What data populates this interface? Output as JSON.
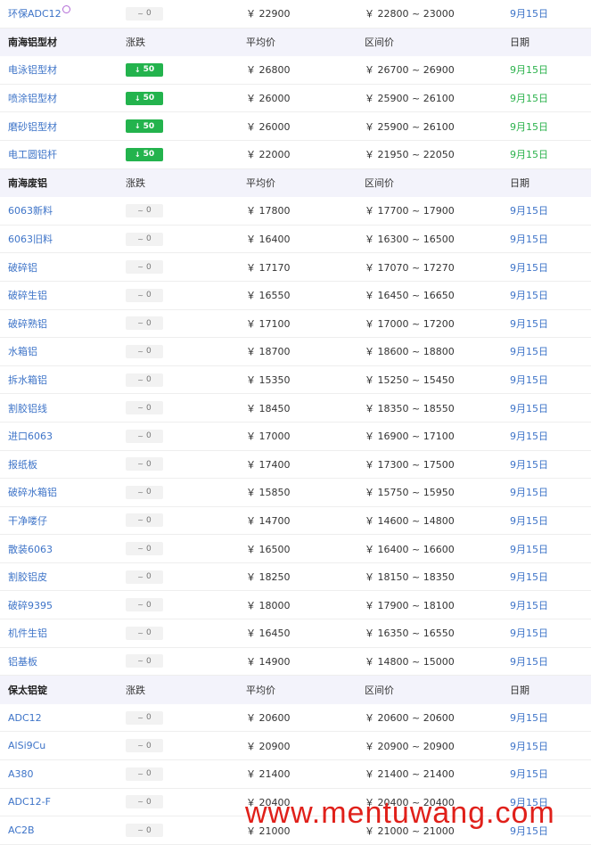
{
  "sections": [
    {
      "header": null,
      "rows": [
        {
          "name": "环保ADC12",
          "tag": true,
          "change": "0",
          "change_type": "flat",
          "avg": "￥ 22900",
          "range": "￥ 22800 ~ 23000",
          "date": "9月15日"
        }
      ]
    },
    {
      "header": {
        "title": "南海铝型材",
        "change": "涨跌",
        "avg": "平均价",
        "range": "区间价",
        "date": "日期"
      },
      "rows": [
        {
          "name": "电泳铝型材",
          "change": "50",
          "change_type": "down",
          "avg": "￥ 26800",
          "range": "￥ 26700 ~ 26900",
          "date": "9月15日",
          "date_color": "green"
        },
        {
          "name": "喷涂铝型材",
          "change": "50",
          "change_type": "down",
          "avg": "￥ 26000",
          "range": "￥ 25900 ~ 26100",
          "date": "9月15日",
          "date_color": "green"
        },
        {
          "name": "磨砂铝型材",
          "change": "50",
          "change_type": "down",
          "avg": "￥ 26000",
          "range": "￥ 25900 ~ 26100",
          "date": "9月15日",
          "date_color": "green"
        },
        {
          "name": "电工圆铝杆",
          "change": "50",
          "change_type": "down",
          "avg": "￥ 22000",
          "range": "￥ 21950 ~ 22050",
          "date": "9月15日",
          "date_color": "green"
        }
      ]
    },
    {
      "header": {
        "title": "南海废铝",
        "change": "涨跌",
        "avg": "平均价",
        "range": "区间价",
        "date": "日期"
      },
      "rows": [
        {
          "name": "6063新料",
          "change": "0",
          "change_type": "flat",
          "avg": "￥ 17800",
          "range": "￥ 17700 ~ 17900",
          "date": "9月15日"
        },
        {
          "name": "6063旧料",
          "change": "0",
          "change_type": "flat",
          "avg": "￥ 16400",
          "range": "￥ 16300 ~ 16500",
          "date": "9月15日"
        },
        {
          "name": "破碎铝",
          "change": "0",
          "change_type": "flat",
          "avg": "￥ 17170",
          "range": "￥ 17070 ~ 17270",
          "date": "9月15日"
        },
        {
          "name": "破碎生铝",
          "change": "0",
          "change_type": "flat",
          "avg": "￥ 16550",
          "range": "￥ 16450 ~ 16650",
          "date": "9月15日"
        },
        {
          "name": "破碎熟铝",
          "change": "0",
          "change_type": "flat",
          "avg": "￥ 17100",
          "range": "￥ 17000 ~ 17200",
          "date": "9月15日"
        },
        {
          "name": "水箱铝",
          "change": "0",
          "change_type": "flat",
          "avg": "￥ 18700",
          "range": "￥ 18600 ~ 18800",
          "date": "9月15日"
        },
        {
          "name": "拆水箱铝",
          "change": "0",
          "change_type": "flat",
          "avg": "￥ 15350",
          "range": "￥ 15250 ~ 15450",
          "date": "9月15日"
        },
        {
          "name": "割胶铝线",
          "change": "0",
          "change_type": "flat",
          "avg": "￥ 18450",
          "range": "￥ 18350 ~ 18550",
          "date": "9月15日"
        },
        {
          "name": "进口6063",
          "change": "0",
          "change_type": "flat",
          "avg": "￥ 17000",
          "range": "￥ 16900 ~ 17100",
          "date": "9月15日"
        },
        {
          "name": "报纸板",
          "change": "0",
          "change_type": "flat",
          "avg": "￥ 17400",
          "range": "￥ 17300 ~ 17500",
          "date": "9月15日"
        },
        {
          "name": "破碎水箱铝",
          "change": "0",
          "change_type": "flat",
          "avg": "￥ 15850",
          "range": "￥ 15750 ~ 15950",
          "date": "9月15日"
        },
        {
          "name": "干净喽仔",
          "change": "0",
          "change_type": "flat",
          "avg": "￥ 14700",
          "range": "￥ 14600 ~ 14800",
          "date": "9月15日"
        },
        {
          "name": "散装6063",
          "change": "0",
          "change_type": "flat",
          "avg": "￥ 16500",
          "range": "￥ 16400 ~ 16600",
          "date": "9月15日"
        },
        {
          "name": "割胶铝皮",
          "change": "0",
          "change_type": "flat",
          "avg": "￥ 18250",
          "range": "￥ 18150 ~ 18350",
          "date": "9月15日"
        },
        {
          "name": "破碎9395",
          "change": "0",
          "change_type": "flat",
          "avg": "￥ 18000",
          "range": "￥ 17900 ~ 18100",
          "date": "9月15日"
        },
        {
          "name": "机件生铝",
          "change": "0",
          "change_type": "flat",
          "avg": "￥ 16450",
          "range": "￥ 16350 ~ 16550",
          "date": "9月15日"
        },
        {
          "name": "铝基板",
          "change": "0",
          "change_type": "flat",
          "avg": "￥ 14900",
          "range": "￥ 14800 ~ 15000",
          "date": "9月15日"
        }
      ]
    },
    {
      "header": {
        "title": "保太铝锭",
        "change": "涨跌",
        "avg": "平均价",
        "range": "区间价",
        "date": "日期"
      },
      "rows": [
        {
          "name": "ADC12",
          "change": "0",
          "change_type": "flat",
          "avg": "￥ 20600",
          "range": "￥ 20600 ~ 20600",
          "date": "9月15日"
        },
        {
          "name": "AlSi9Cu",
          "change": "0",
          "change_type": "flat",
          "avg": "￥ 20900",
          "range": "￥ 20900 ~ 20900",
          "date": "9月15日"
        },
        {
          "name": "A380",
          "change": "0",
          "change_type": "flat",
          "avg": "￥ 21400",
          "range": "￥ 21400 ~ 21400",
          "date": "9月15日"
        },
        {
          "name": "ADC12-F",
          "change": "0",
          "change_type": "flat",
          "avg": "￥ 20400",
          "range": "￥ 20400 ~ 20400",
          "date": "9月15日"
        },
        {
          "name": "AC2B",
          "change": "0",
          "change_type": "flat",
          "avg": "￥ 21000",
          "range": "￥ 21000 ~ 21000",
          "date": "9月15日"
        }
      ]
    }
  ],
  "icons": {
    "flat": "~",
    "down": "↓"
  },
  "colors": {
    "link": "#3e74c8",
    "green": "#23b34d",
    "header_bg": "#f3f3fb",
    "watermark": "#e0201a"
  },
  "watermark": "www.mentuwang.com"
}
